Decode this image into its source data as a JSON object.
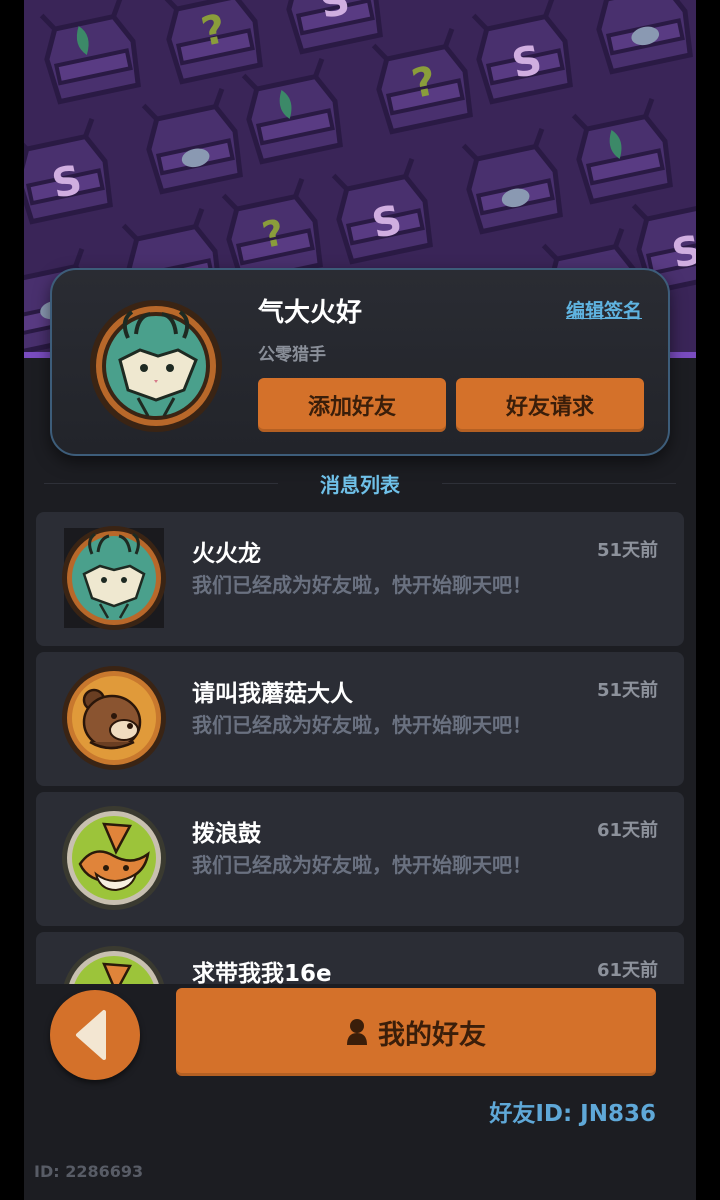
{
  "profile": {
    "name": "气大火好",
    "subtitle": "公零猎手",
    "edit_sign_label": "编辑签名",
    "add_friend_label": "添加好友",
    "friend_request_label": "好友请求"
  },
  "section": {
    "title": "消息列表"
  },
  "messages": [
    {
      "name": "火火龙",
      "text": "我们已经成为好友啦，快开始聊天吧！",
      "time": "51天前",
      "avatar": "cat-antler-avatar"
    },
    {
      "name": "请叫我蘑菇大人",
      "text": "我们已经成为好友啦，快开始聊天吧！",
      "time": "51天前",
      "avatar": "bear-avatar"
    },
    {
      "name": "拨浪鼓",
      "text": "我们已经成为好友啦，快开始聊天吧！",
      "time": "61天前",
      "avatar": "fox-avatar"
    },
    {
      "name": "求带我我16e",
      "text": "",
      "time": "61天前",
      "avatar": "fox-avatar"
    }
  ],
  "bottom": {
    "back_icon": "chevron-left-icon",
    "my_friends_label": "我的好友",
    "friend_icon": "person-icon",
    "friend_id": "好友ID: JN836",
    "user_id": "ID: 2286693"
  },
  "colors": {
    "accent": "#d4712a",
    "link": "#5fb3e0",
    "background": "#1c1d22",
    "card": "#2b2d35",
    "banner": "#3a2558"
  }
}
